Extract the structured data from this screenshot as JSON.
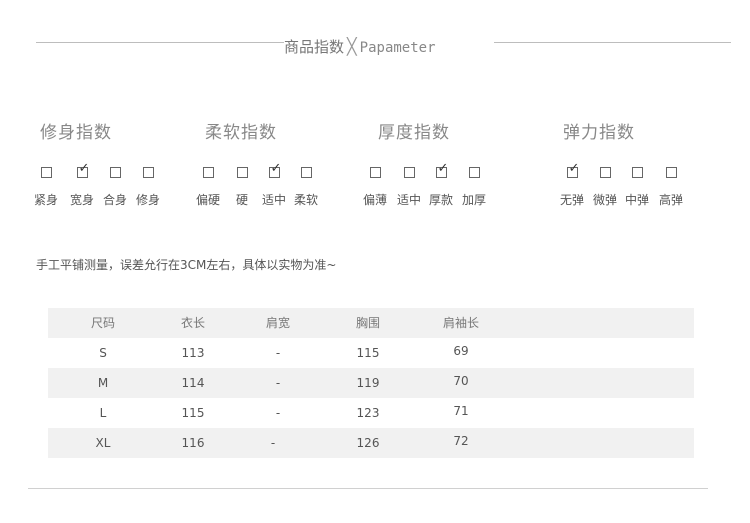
{
  "header": {
    "title_cn": "商品指数",
    "separator": "╳",
    "title_en": "Papameter"
  },
  "groups": [
    {
      "title": "修身指数",
      "options": [
        {
          "label": "紧身",
          "checked": false
        },
        {
          "label": "宽身",
          "checked": true
        },
        {
          "label": "合身",
          "checked": false
        },
        {
          "label": "修身",
          "checked": false
        }
      ]
    },
    {
      "title": "柔软指数",
      "options": [
        {
          "label": "偏硬",
          "checked": false
        },
        {
          "label": "硬",
          "checked": false
        },
        {
          "label": "适中",
          "checked": true
        },
        {
          "label": "柔软",
          "checked": false
        }
      ]
    },
    {
      "title": "厚度指数",
      "options": [
        {
          "label": "偏薄",
          "checked": false
        },
        {
          "label": "适中",
          "checked": false
        },
        {
          "label": "厚款",
          "checked": true
        },
        {
          "label": "加厚",
          "checked": false
        }
      ]
    },
    {
      "title": "弹力指数",
      "options": [
        {
          "label": "无弹",
          "checked": true
        },
        {
          "label": "微弹",
          "checked": false
        },
        {
          "label": "中弹",
          "checked": false
        },
        {
          "label": "高弹",
          "checked": false
        }
      ]
    }
  ],
  "check_mark": "✓",
  "note": "手工平铺测量，误差允行在3CM左右，具体以实物为准~",
  "size_table": {
    "headers": [
      "尺码",
      "衣长",
      "肩宽",
      "胸围",
      "肩袖长"
    ],
    "rows": [
      [
        "S",
        "113",
        "-",
        "115",
        "69"
      ],
      [
        "M",
        "114",
        "-",
        "119",
        "70"
      ],
      [
        "L",
        "115",
        "-",
        "123",
        "71"
      ],
      [
        "XL",
        "116",
        "-",
        "126",
        "72"
      ]
    ]
  }
}
